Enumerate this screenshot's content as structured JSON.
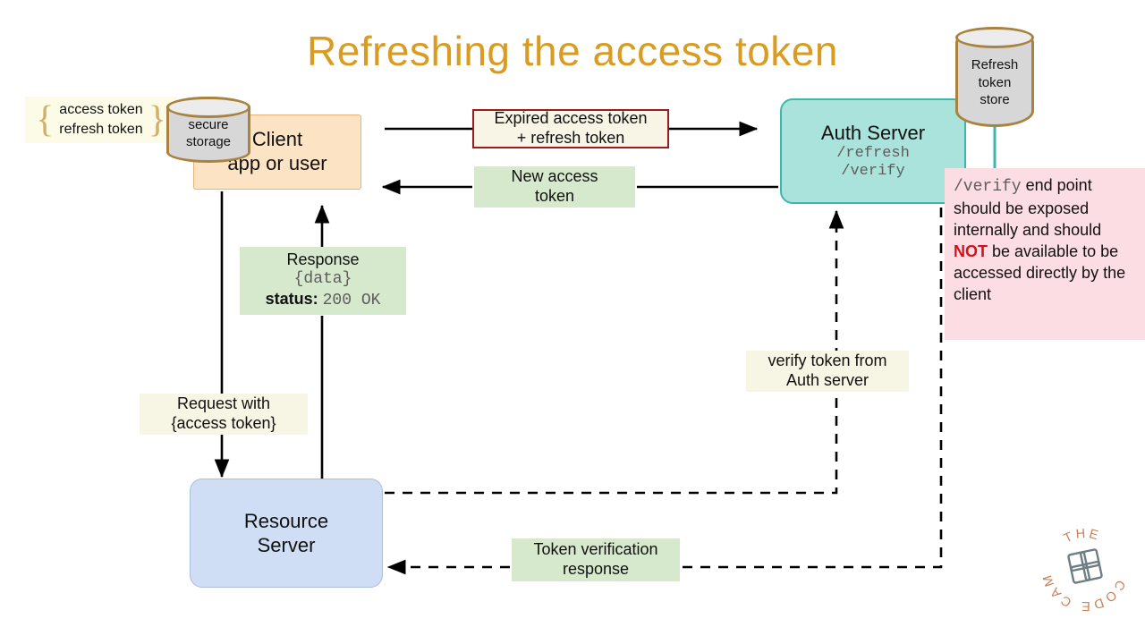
{
  "title": "Refreshing the access token",
  "nodes": {
    "client": {
      "line1": "Client",
      "line2": "app or user"
    },
    "auth_server": {
      "title": "Auth Server",
      "endpoint1": "/refresh",
      "endpoint2": "/verify"
    },
    "resource_server": {
      "line1": "Resource",
      "line2": "Server"
    },
    "secure_storage": {
      "line1": "secure",
      "line2": "storage"
    },
    "refresh_token_store": {
      "line1": "Refresh",
      "line2": "token",
      "line3": "store"
    }
  },
  "token_brace": {
    "open": "{",
    "close": "}",
    "line1": "access token",
    "line2": "refresh token"
  },
  "labels": {
    "expired_token": {
      "line1": "Expired access token",
      "line2": "+ refresh token"
    },
    "new_access_token": {
      "line1": "New access",
      "line2": "token"
    },
    "response": {
      "line1": "Response",
      "line2": "{data}",
      "status_key": "status:",
      "status_value": "200 OK"
    },
    "request": {
      "line1": "Request with",
      "line2": "{access token}"
    },
    "verify_token": {
      "line1": "verify token from",
      "line2": "Auth server"
    },
    "token_verification": {
      "line1": "Token verification",
      "line2": "response"
    }
  },
  "note": {
    "part1": "/verify",
    "part2": " end point should be exposed internally and should ",
    "emphasis": "NOT",
    "part3": " be available to be accessed directly by the client"
  },
  "logo": {
    "word1": "THE",
    "word2": "CODE",
    "word3": "CAMP"
  },
  "colors": {
    "title": "#d99c23",
    "client_fill": "#fce3c3",
    "client_stroke": "#e8b477",
    "auth_fill": "#a9e3dc",
    "auth_stroke": "#3fb6ab",
    "resource_fill": "#cfdef4",
    "resource_stroke": "#a8bedd",
    "green_chip": "#d6e9cd",
    "ivory_chip": "#f7f5e4",
    "expired_border": "#9b1c1c",
    "pink_note": "#fbdde3",
    "note_emphasis": "#d2121a",
    "cylinder_fill": "#d7d7d7",
    "cylinder_stroke": "#a8823f",
    "arrow": "#000000",
    "logo": "#c8825a"
  }
}
